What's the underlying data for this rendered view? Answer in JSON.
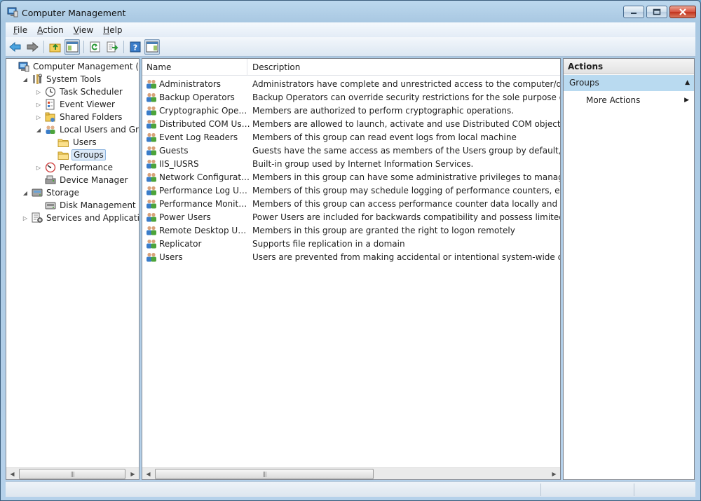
{
  "window": {
    "title": "Computer Management",
    "controls": {
      "minimize": "minimize",
      "maximize": "maximize",
      "close": "close"
    }
  },
  "menu": [
    {
      "label": "File",
      "accel": "F",
      "rest": "ile"
    },
    {
      "label": "Action",
      "accel": "A",
      "rest": "ction"
    },
    {
      "label": "View",
      "accel": "V",
      "rest": "iew"
    },
    {
      "label": "Help",
      "accel": "H",
      "rest": "elp"
    }
  ],
  "toolbar": [
    "back-arrow-icon",
    "forward-arrow-icon",
    "up-folder-icon",
    "show-hide-tree-icon",
    "refresh-icon",
    "export-list-icon",
    "help-icon",
    "show-hide-action-pane-icon"
  ],
  "tree": [
    {
      "label": "Computer Management (Local",
      "level": 0,
      "expander": "none",
      "icon": "computer-icon"
    },
    {
      "label": "System Tools",
      "level": 1,
      "expander": "expanded",
      "icon": "tools-icon"
    },
    {
      "label": "Task Scheduler",
      "level": 2,
      "expander": "collapsed",
      "icon": "clock-icon"
    },
    {
      "label": "Event Viewer",
      "level": 2,
      "expander": "collapsed",
      "icon": "event-viewer-icon"
    },
    {
      "label": "Shared Folders",
      "level": 2,
      "expander": "collapsed",
      "icon": "shared-folder-icon"
    },
    {
      "label": "Local Users and Groups",
      "level": 2,
      "expander": "expanded",
      "icon": "users-icon"
    },
    {
      "label": "Users",
      "level": 3,
      "expander": "none",
      "icon": "folder-icon"
    },
    {
      "label": "Groups",
      "level": 3,
      "expander": "none",
      "icon": "folder-icon",
      "selected": true
    },
    {
      "label": "Performance",
      "level": 2,
      "expander": "collapsed",
      "icon": "performance-icon"
    },
    {
      "label": "Device Manager",
      "level": 2,
      "expander": "none",
      "icon": "device-manager-icon"
    },
    {
      "label": "Storage",
      "level": 1,
      "expander": "expanded",
      "icon": "storage-icon"
    },
    {
      "label": "Disk Management",
      "level": 2,
      "expander": "none",
      "icon": "disk-icon"
    },
    {
      "label": "Services and Applications",
      "level": 1,
      "expander": "collapsed",
      "icon": "services-icon"
    }
  ],
  "list": {
    "columns": {
      "name": "Name",
      "description": "Description"
    },
    "rows": [
      {
        "name": "Administrators",
        "description": "Administrators have complete and unrestricted access to the computer/domain"
      },
      {
        "name": "Backup Operators",
        "description": "Backup Operators can override security restrictions for the sole purpose of backing"
      },
      {
        "name": "Cryptographic Operat...",
        "description": "Members are authorized to perform cryptographic operations."
      },
      {
        "name": "Distributed COM Users",
        "description": "Members are allowed to launch, activate and use Distributed COM objects on this n"
      },
      {
        "name": "Event Log Readers",
        "description": "Members of this group can read event logs from local machine"
      },
      {
        "name": "Guests",
        "description": "Guests have the same access as members of the Users group by default, except for t"
      },
      {
        "name": "IIS_IUSRS",
        "description": "Built-in group used by Internet Information Services."
      },
      {
        "name": "Network Configuratio...",
        "description": "Members in this group can have some administrative privileges to manage configu"
      },
      {
        "name": "Performance Log Users",
        "description": "Members of this group may schedule logging of performance counters, enable trac"
      },
      {
        "name": "Performance Monitor ...",
        "description": "Members of this group can access performance counter data locally and remotely"
      },
      {
        "name": "Power Users",
        "description": "Power Users are included for backwards compatibility and possess limited administ"
      },
      {
        "name": "Remote Desktop Users",
        "description": "Members in this group are granted the right to logon remotely"
      },
      {
        "name": "Replicator",
        "description": "Supports file replication in a domain"
      },
      {
        "name": "Users",
        "description": "Users are prevented from making accidental or intentional system-wide changes an"
      }
    ]
  },
  "actions": {
    "header": "Actions",
    "group": "Groups",
    "items": [
      "More Actions"
    ]
  }
}
